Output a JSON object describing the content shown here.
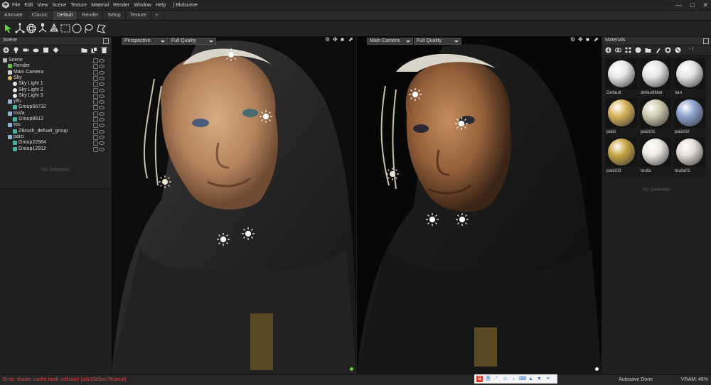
{
  "menubar": {
    "items": [
      "File",
      "Edit",
      "View",
      "Scene",
      "Texture",
      "Material",
      "Render",
      "Window",
      "Help"
    ],
    "app_title": "| Bkdscene",
    "window_buttons": [
      "—",
      "□",
      "✕"
    ]
  },
  "tabs": [
    "Animate",
    "Classic",
    "Default",
    "Render",
    "Setup",
    "Texture",
    "+"
  ],
  "active_tab": "Default",
  "scene_panel": {
    "title": "Scene",
    "tree": [
      {
        "label": "Scene",
        "level": 0,
        "icon": "scene-icon"
      },
      {
        "label": "Render",
        "level": 1,
        "icon": "render-icon"
      },
      {
        "label": "Main Camera",
        "level": 1,
        "icon": "camera-icon"
      },
      {
        "label": "Sky",
        "level": 1,
        "icon": "sky-icon"
      },
      {
        "label": "Sky Light 1",
        "level": 2,
        "icon": "light-icon"
      },
      {
        "label": "Sky Light 2",
        "level": 2,
        "icon": "light-icon"
      },
      {
        "label": "Sky Light 3",
        "level": 2,
        "icon": "light-icon"
      },
      {
        "label": "yifu",
        "level": 1,
        "icon": "model-icon"
      },
      {
        "label": "Group56732",
        "level": 2,
        "icon": "group-icon"
      },
      {
        "label": "toufa",
        "level": 1,
        "icon": "model-icon"
      },
      {
        "label": "Group8612",
        "level": 2,
        "icon": "group-icon"
      },
      {
        "label": "tou",
        "level": 1,
        "icon": "model-icon"
      },
      {
        "label": "ZBrush_defualt_group",
        "level": 2,
        "icon": "group-icon"
      },
      {
        "label": "paizi",
        "level": 1,
        "icon": "model-icon"
      },
      {
        "label": "Group22984",
        "level": 2,
        "icon": "group-icon"
      },
      {
        "label": "Group12912",
        "level": 2,
        "icon": "group-icon"
      }
    ],
    "no_selection": "No Selection"
  },
  "viewport_left": {
    "camera": "Perspective",
    "quality": "Full Quality"
  },
  "viewport_right": {
    "camera": "Main Camera",
    "quality": "Full Quality"
  },
  "materials_panel": {
    "title": "Materials",
    "page": "- /",
    "items": [
      {
        "name": "Default",
        "color": "#e8e8ea"
      },
      {
        "name": "defaultMat",
        "color": "#e6e6e8"
      },
      {
        "name": "lian",
        "color": "#e4e4e6"
      },
      {
        "name": "paizi",
        "color": "#d9b35a"
      },
      {
        "name": "paizi01",
        "color": "#cfc9ad"
      },
      {
        "name": "paizi02",
        "color": "#8ea3cf"
      },
      {
        "name": "paizi03",
        "color": "#c9a544"
      },
      {
        "name": "toufa",
        "color": "#ece9e0"
      },
      {
        "name": "toufa01",
        "color": "#e6ddd8"
      }
    ],
    "no_selection": "No Selection"
  },
  "statusbar": {
    "error": "Error: shader cache hash collision! (a3c93d5ee7fe3ec8)",
    "autosave": "Autosave Done",
    "vram": "VRAM: 46%"
  },
  "colors": {
    "error": "#e04848",
    "accent_green": "#6ccf3a",
    "face_left": "#c79a72",
    "face_right": "#a87246",
    "cloak": "#2a2a2a"
  }
}
